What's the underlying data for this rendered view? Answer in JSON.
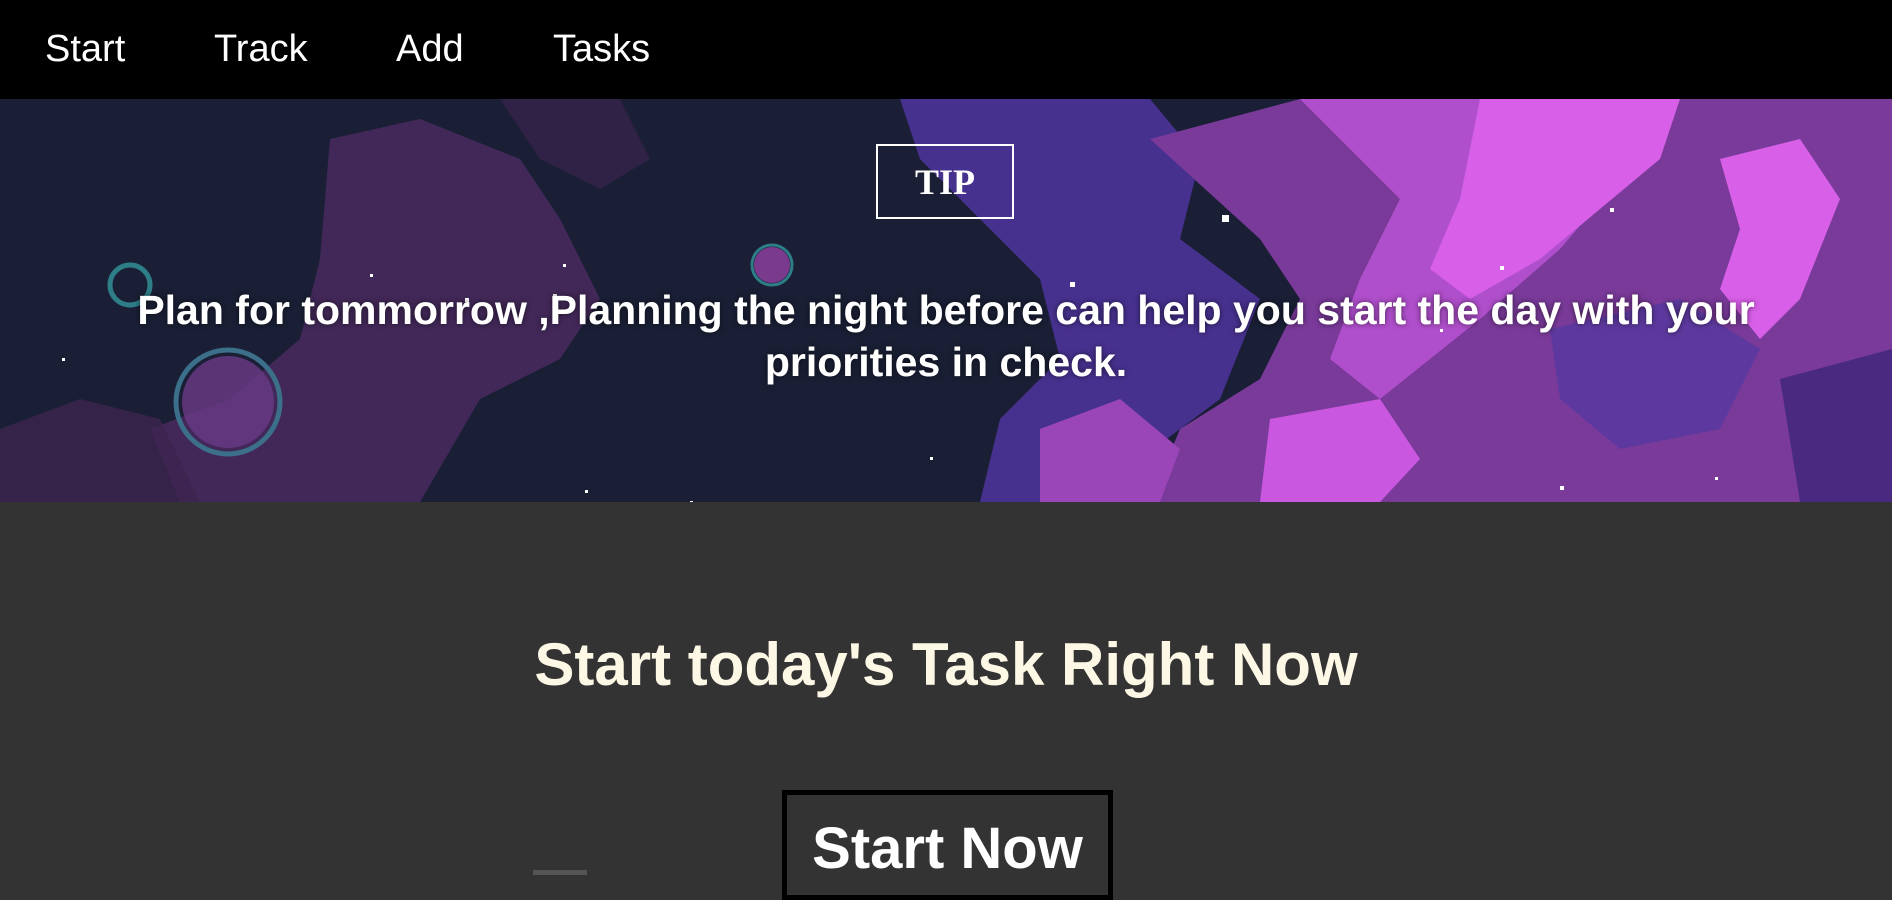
{
  "nav": {
    "items": [
      {
        "label": "Start"
      },
      {
        "label": "Track"
      },
      {
        "label": "Add"
      },
      {
        "label": "Tasks"
      }
    ]
  },
  "tip": {
    "badge": "TIP",
    "text": "Plan for tommorrow ,Planning the night before can help you start the day with your priorities in check."
  },
  "cta": {
    "heading": "Start today's Task Right Now",
    "button_label": "Start Now"
  },
  "colors": {
    "navbar_bg": "#000000",
    "page_bg": "#333333",
    "heading_color": "#fdf8e6",
    "hero_dark": "#1a1f35",
    "hero_purple": "#8a3f9e",
    "hero_pink": "#d85fe8",
    "hero_violet": "#4d3399"
  },
  "icons": {
    "hero_background": "pixel-art-space-nebula"
  }
}
